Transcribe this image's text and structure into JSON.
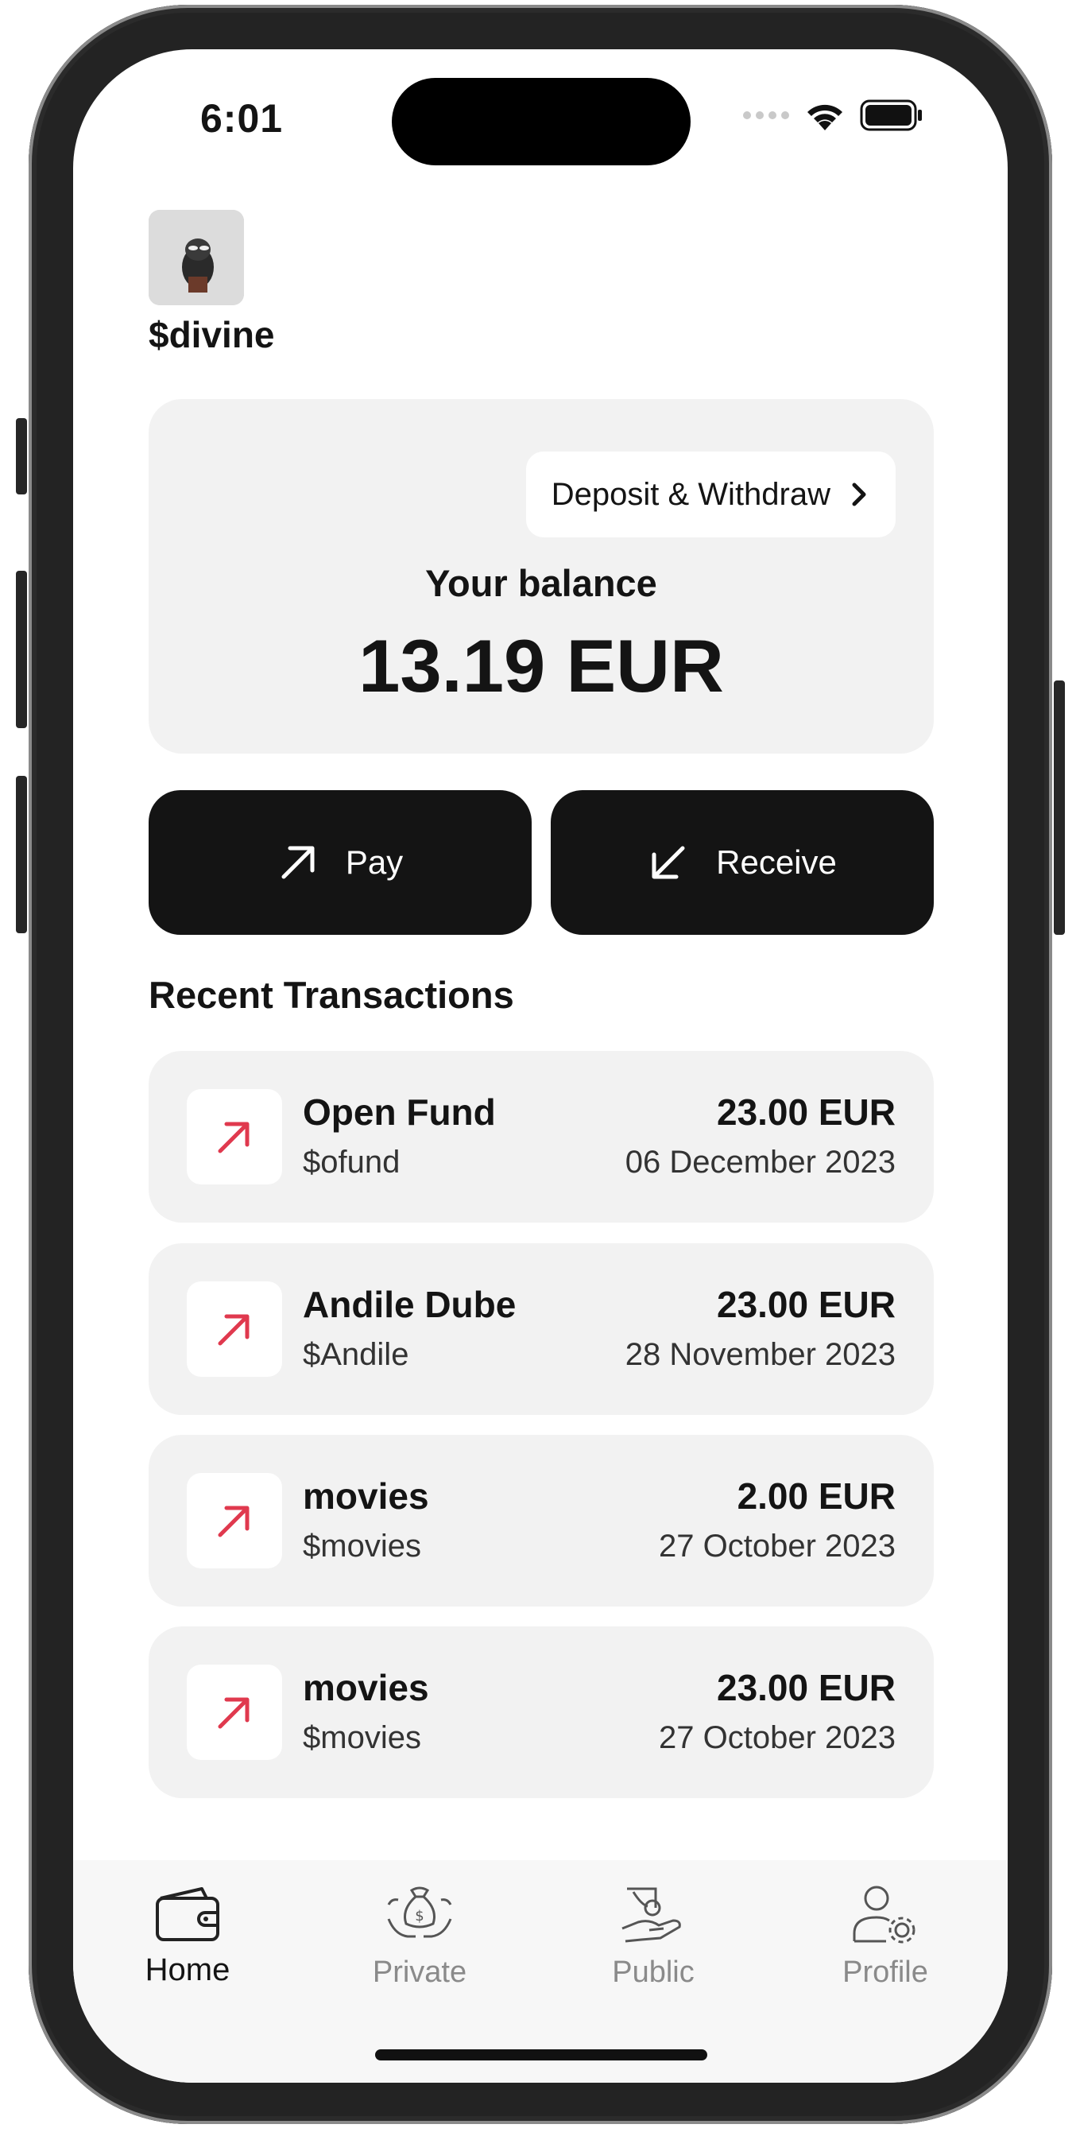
{
  "status_bar": {
    "time": "6:01"
  },
  "profile": {
    "username": "$divine"
  },
  "balance": {
    "deposit_withdraw_label": "Deposit & Withdraw",
    "label": "Your balance",
    "amount": "13.19 EUR"
  },
  "actions": {
    "pay_label": "Pay",
    "receive_label": "Receive"
  },
  "transactions": {
    "title": "Recent Transactions",
    "items": [
      {
        "name": "Open Fund",
        "handle": "$ofund",
        "amount": "23.00 EUR",
        "date": "06 December 2023"
      },
      {
        "name": "Andile Dube",
        "handle": "$Andile",
        "amount": "23.00 EUR",
        "date": "28 November 2023"
      },
      {
        "name": "movies",
        "handle": "$movies",
        "amount": "2.00 EUR",
        "date": "27 October 2023"
      },
      {
        "name": "movies",
        "handle": "$movies",
        "amount": "23.00 EUR",
        "date": "27 October 2023"
      }
    ]
  },
  "tabs": [
    {
      "label": "Home",
      "icon": "wallet-icon",
      "active": true
    },
    {
      "label": "Private",
      "icon": "money-bag-hands-icon",
      "active": false
    },
    {
      "label": "Public",
      "icon": "hand-coin-icon",
      "active": false
    },
    {
      "label": "Profile",
      "icon": "user-settings-icon",
      "active": false
    }
  ],
  "colors": {
    "outgoing_arrow": "#e0394e",
    "button_dark": "#141414",
    "card_bg": "#f2f2f2"
  }
}
